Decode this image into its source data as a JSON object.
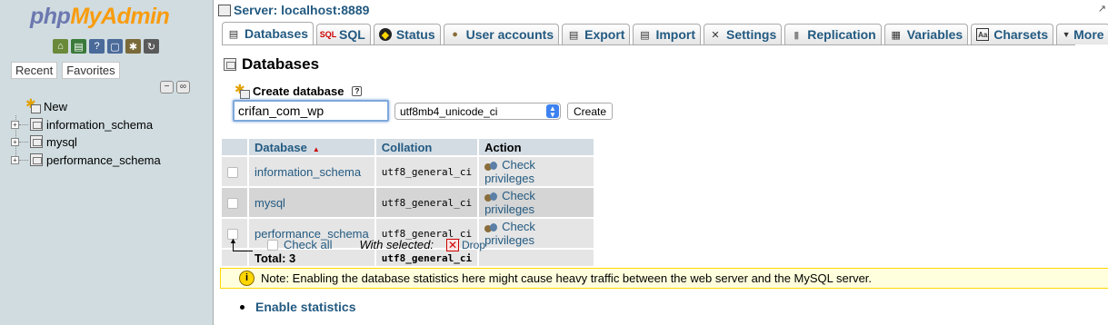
{
  "nav": {
    "logo_php": "php",
    "logo_myadmin": "MyAdmin",
    "icons": [
      "home-icon",
      "exit-icon",
      "docs-icon",
      "help-icon",
      "settings-icon",
      "reload-icon"
    ],
    "tabs": [
      {
        "label": "Recent"
      },
      {
        "label": "Favorites"
      }
    ],
    "tree": [
      {
        "label": "New"
      },
      {
        "label": "information_schema"
      },
      {
        "label": "mysql"
      },
      {
        "label": "performance_schema"
      }
    ]
  },
  "header": {
    "server": "Server: localhost:8889"
  },
  "tabs": [
    {
      "label": "Databases",
      "icon": "database-icon",
      "active": true
    },
    {
      "label": "SQL",
      "icon": "sql-icon"
    },
    {
      "label": "Status",
      "icon": "status-icon"
    },
    {
      "label": "User accounts",
      "icon": "users-icon"
    },
    {
      "label": "Export",
      "icon": "export-icon"
    },
    {
      "label": "Import",
      "icon": "import-icon"
    },
    {
      "label": "Settings",
      "icon": "settings-icon"
    },
    {
      "label": "Replication",
      "icon": "replication-icon"
    },
    {
      "label": "Variables",
      "icon": "variables-icon"
    },
    {
      "label": "Charsets",
      "icon": "charsets-icon"
    },
    {
      "label": "More",
      "icon": "caret-down-icon"
    }
  ],
  "page": {
    "title": "Databases",
    "create_label": "Create database",
    "db_name_value": "crifan_com_wp",
    "collation_value": "utf8mb4_unicode_ci",
    "create_button": "Create"
  },
  "table": {
    "headers": {
      "database": "Database",
      "collation": "Collation",
      "action": "Action"
    },
    "rows": [
      {
        "name": "information_schema",
        "collation": "utf8_general_ci",
        "action": "Check privileges"
      },
      {
        "name": "mysql",
        "collation": "utf8_general_ci",
        "action": "Check privileges"
      },
      {
        "name": "performance_schema",
        "collation": "utf8_general_ci",
        "action": "Check privileges"
      }
    ],
    "total_label": "Total: 3",
    "total_collation": "utf8_general_ci"
  },
  "bulk": {
    "check_all": "Check all",
    "with_selected": "With selected:",
    "drop": "Drop"
  },
  "notice": "Note: Enabling the database statistics here might cause heavy traffic between the web server and the MySQL server.",
  "enable_stats": "Enable statistics",
  "colors": {
    "link": "#235a81",
    "nav_bg": "#d0dce0",
    "logo_php": "#6c78af",
    "logo_myadmin": "#f89c0e",
    "notice_bg": "#ffffdd"
  }
}
